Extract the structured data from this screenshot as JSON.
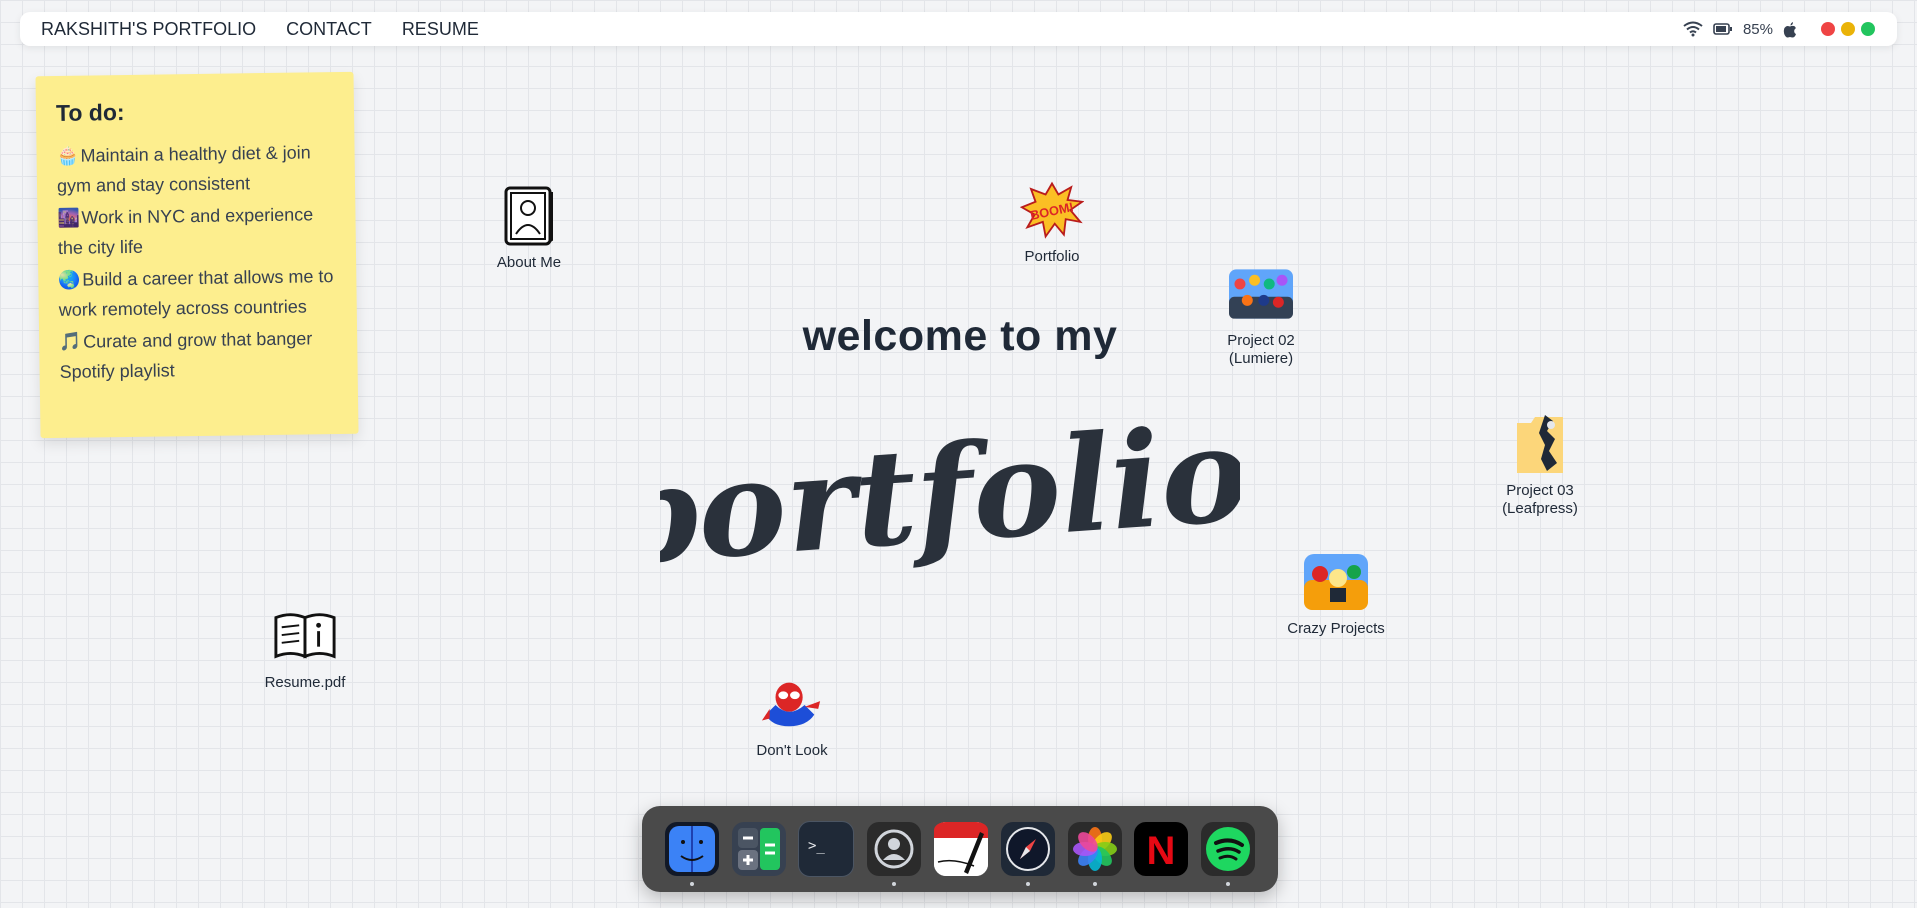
{
  "topbar": {
    "brand": "RAKSHITH'S PORTFOLIO",
    "links": [
      "CONTACT",
      "RESUME"
    ],
    "battery": "85%",
    "window_dots": [
      "#ef4444",
      "#eab308",
      "#22c55e"
    ]
  },
  "note": {
    "title": "To do:",
    "items": [
      {
        "emoji": "🧁",
        "text": "Maintain a healthy diet & join gym and stay consistent"
      },
      {
        "emoji": "🌆",
        "text": "Work in NYC and experience the city life"
      },
      {
        "emoji": "🌏",
        "text": "Build a career that allows me to work remotely across countries"
      },
      {
        "emoji": "🎵",
        "text": "Curate and grow that banger Spotify playlist"
      }
    ]
  },
  "desktop": {
    "about": "About Me",
    "portfolio": "Portfolio",
    "boom": "BOOM!",
    "project02": "Project 02 (Lumiere)",
    "project03": "Project 03 (Leafpress)",
    "crazy": "Crazy Projects",
    "resume": "Resume.pdf",
    "dontlook": "Don't Look"
  },
  "hero": {
    "welcome": "welcome to my",
    "script": "portfolio."
  },
  "dock": {
    "apps": [
      "finder-icon",
      "calculator-icon",
      "terminal-icon",
      "contacts-icon",
      "notes-icon",
      "safari-icon",
      "photos-icon",
      "netflix-icon",
      "spotify-icon"
    ],
    "netflix_letter": "N",
    "terminal_prompt": ">_"
  },
  "colors": {
    "accent_dark": "#2a313b",
    "note_bg": "#fdee8e",
    "dock_bg": "#4a4a4a"
  }
}
